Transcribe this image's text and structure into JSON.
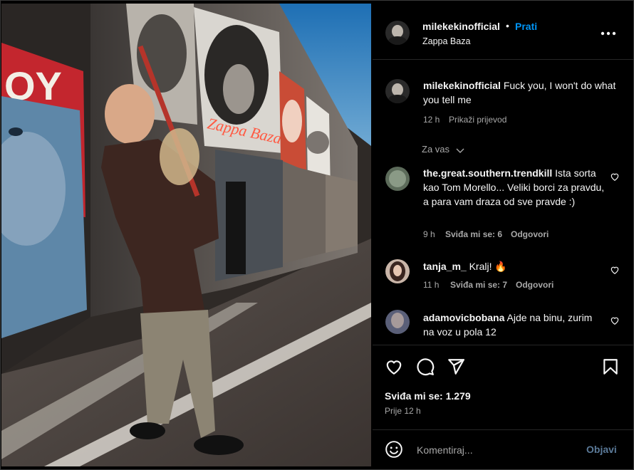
{
  "post": {
    "username": "milekekinofficial",
    "separator": "•",
    "follow_label": "Prati",
    "location": "Zappa Baza",
    "more_label": "•••"
  },
  "caption": {
    "username": "milekekinofficial",
    "text": "Fuck you, I won't do what you tell me",
    "time": "12 h",
    "translate_label": "Prikaži prijevod"
  },
  "sort_label": "Za vas",
  "comments": [
    {
      "username": "the.great.southern.trendkill",
      "text": "Ista sorta kao Tom Morello... Veliki borci za pravdu, a para vam draza od sve pravde :)",
      "time": "9 h",
      "likes": "Sviđa mi se: 6",
      "reply_label": "Odgovori"
    },
    {
      "username": "tanja_m_",
      "text": "Kralj! 🔥",
      "time": "11 h",
      "likes": "Sviđa mi se: 7",
      "reply_label": "Odgovori"
    },
    {
      "username": "adamovicbobana",
      "text": "Ajde na binu, zurim na voz u pola 12",
      "time": "",
      "likes": "",
      "reply_label": ""
    }
  ],
  "likes_summary": "Sviđa mi se: 1.279",
  "posted_time": "Prije 12 h",
  "composer": {
    "placeholder": "Komentiraj...",
    "post_label": "Objavi"
  },
  "colors": {
    "accent": "#0095f6",
    "background": "#000000",
    "secondary_text": "#a8a8a8"
  },
  "icons": [
    "like-icon",
    "comment-icon",
    "share-icon",
    "save-icon",
    "emoji-icon",
    "more-icon",
    "chevron-down-icon"
  ]
}
